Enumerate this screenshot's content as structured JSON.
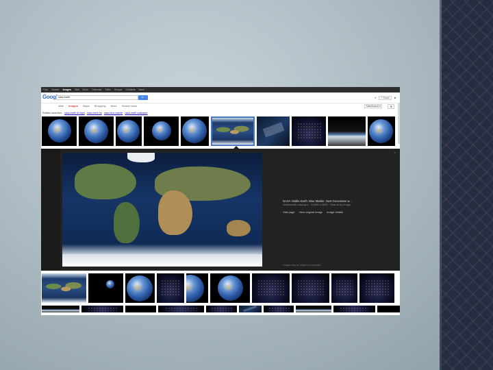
{
  "gbar": {
    "items": [
      "+You",
      "Search",
      "Images",
      "Mail",
      "Drive",
      "Calendar",
      "Sites",
      "Groups",
      "Contacts",
      "More"
    ],
    "active_index": 2
  },
  "header": {
    "logo": "Google",
    "query": "nasa earth",
    "search_button": "🔍",
    "share": "+ Share",
    "profile": "▾"
  },
  "tabs": {
    "items": [
      "Web",
      "Images",
      "Maps",
      "Shopping",
      "More",
      "Search tools"
    ],
    "active_index": 1,
    "safesearch": "SafeSearch ▾",
    "settings": "⚙"
  },
  "related": {
    "label": "Related searches:",
    "items": [
      "nasa earth at night",
      "nasa earth hd",
      "nasa blue marble",
      "nasa earth wallpaper"
    ]
  },
  "preview": {
    "title": "NASA Visible Earth: Blue Marble: Next Generation w...",
    "domain": "visibleearth.nasa.gov · 21600×10800 · Search by image",
    "links": [
      "Visit page",
      "View original image",
      "Image details"
    ],
    "note": "Images may be subject to copyright.",
    "close": "×"
  },
  "icons": {
    "thumb_types": [
      "earth",
      "earth",
      "earth",
      "earth",
      "earth",
      "flatmap",
      "iss",
      "night",
      "horizon",
      "earth"
    ]
  }
}
